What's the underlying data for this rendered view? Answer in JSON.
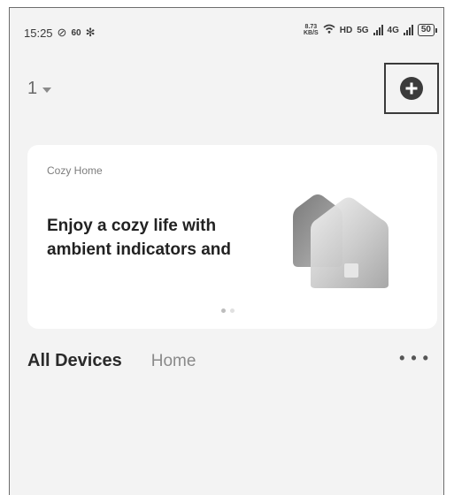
{
  "status_bar": {
    "time": "15:25",
    "indicator": "60",
    "speed_value": "8.73",
    "speed_unit": "KB/S",
    "hd_label": "HD",
    "sim1_label": "5G",
    "sim2_label": "4G",
    "battery": "50"
  },
  "header": {
    "home_name": "1",
    "add_icon": "plus-circle-icon"
  },
  "banner": {
    "tag": "Cozy Home",
    "headline": "Enjoy a cozy life with ambient indicators and",
    "active_slide": 1,
    "slide_count": 2
  },
  "tabs": {
    "active_label": "All Devices",
    "second_label": "Home",
    "more_label": "• • •"
  }
}
